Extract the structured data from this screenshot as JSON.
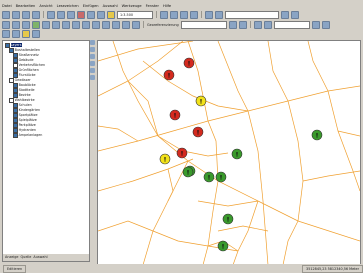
{
  "window": {
    "title": ""
  },
  "menu": [
    "Datei",
    "Bearbeiten",
    "Ansicht",
    "Lesezeichen",
    "Einfügen",
    "Auswahl",
    "Werkzeuge",
    "Fenster",
    "Hilfe"
  ],
  "toolbar": {
    "scale": "1:3.500",
    "layer_combo": "",
    "georef_label": "Georeferenzierung",
    "editor_combo": "",
    "target_combo": ""
  },
  "toc": {
    "root_label": "Layers",
    "items": [
      {
        "label": "Layers",
        "checked": true,
        "selected": true
      },
      {
        "label": "Bushaltestellen",
        "checked": true
      },
      {
        "label": "Straßennetz",
        "checked": true
      },
      {
        "label": "Gebäude",
        "checked": true
      },
      {
        "label": "Verkehrsflächen",
        "checked": false
      },
      {
        "label": "Grünflächen",
        "checked": true
      },
      {
        "label": "Flurstücke",
        "checked": true
      },
      {
        "label": "Gewässer",
        "checked": false
      },
      {
        "label": "Baublöcke",
        "checked": true
      },
      {
        "label": "Stadtteile",
        "checked": true
      },
      {
        "label": "Bezirke",
        "checked": true
      },
      {
        "label": "Wahlbezirke",
        "checked": false
      },
      {
        "label": "Schulen",
        "checked": true
      },
      {
        "label": "Kindergärten",
        "checked": true
      },
      {
        "label": "Sportplätze",
        "checked": true
      },
      {
        "label": "Spielplätze",
        "checked": true
      },
      {
        "label": "Parkplätze",
        "checked": true
      },
      {
        "label": "Hydranten",
        "checked": true
      },
      {
        "label": "Ampelanlagen",
        "checked": true
      }
    ],
    "tabs": [
      "Anzeige",
      "Quelle",
      "Auswahl"
    ]
  },
  "map": {
    "points": [
      {
        "status": "red",
        "glyph": "!"
      },
      {
        "status": "red",
        "glyph": "!"
      },
      {
        "status": "yellow",
        "glyph": "!"
      },
      {
        "status": "red",
        "glyph": "!"
      },
      {
        "status": "red",
        "glyph": "!"
      },
      {
        "status": "yellow",
        "glyph": "!"
      },
      {
        "status": "red",
        "glyph": "!"
      },
      {
        "status": "green",
        "glyph": "!"
      },
      {
        "status": "green",
        "glyph": "!"
      },
      {
        "status": "green",
        "glyph": "!"
      },
      {
        "status": "green",
        "glyph": "!"
      },
      {
        "status": "green",
        "glyph": "!"
      },
      {
        "status": "green",
        "glyph": "!"
      },
      {
        "status": "green",
        "glyph": "!"
      },
      {
        "status": "green",
        "glyph": "!"
      }
    ],
    "colors": {
      "road": "#f0a030",
      "red": "#d42a1e",
      "yellow": "#f2e21a",
      "green": "#3a9a2c",
      "outline": "#333333"
    }
  },
  "status": {
    "coords": "3512845,23  5812340,56 Meter",
    "mode": "Editieren"
  }
}
